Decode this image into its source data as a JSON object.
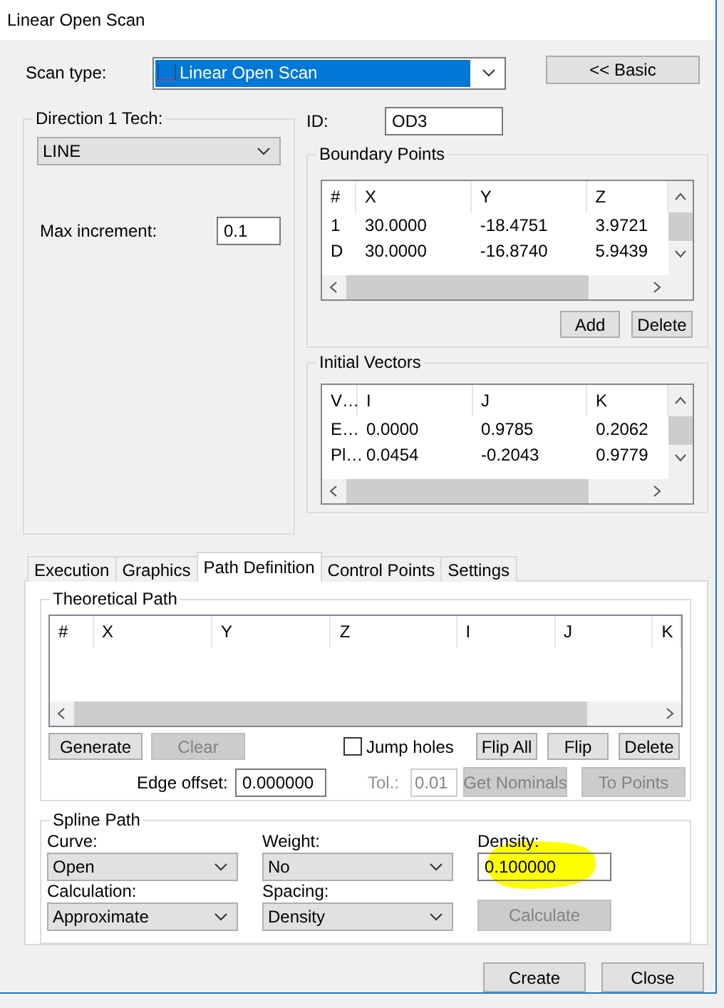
{
  "window": {
    "title": "Linear Open Scan"
  },
  "scan_type": {
    "label": "Scan type:",
    "value": "Linear Open Scan"
  },
  "basic_button": "<< Basic",
  "direction_tech": {
    "title": "Direction 1 Tech:",
    "value": "LINE",
    "max_increment_label": "Max increment:",
    "max_increment": "0.1"
  },
  "id": {
    "label": "ID:",
    "value": "OD3"
  },
  "boundary_points": {
    "title": "Boundary Points",
    "columns": [
      "#",
      "X",
      "Y",
      "Z"
    ],
    "rows": [
      [
        "1",
        "30.0000",
        "-18.4751",
        "3.9721"
      ],
      [
        "D",
        "30.0000",
        "-16.8740",
        "5.9439"
      ]
    ],
    "buttons": [
      "Add",
      "Delete"
    ]
  },
  "initial_vectors": {
    "title": "Initial Vectors",
    "columns": [
      "V…",
      "I",
      "J",
      "K"
    ],
    "rows": [
      [
        "E…",
        "0.0000",
        "0.9785",
        "0.2062"
      ],
      [
        "Pl…",
        "0.0454",
        "-0.2043",
        "0.9779"
      ]
    ]
  },
  "tabs": [
    {
      "label": "Execution",
      "selected": false
    },
    {
      "label": "Graphics",
      "selected": false
    },
    {
      "label": "Path Definition",
      "selected": true
    },
    {
      "label": "Control Points",
      "selected": false
    },
    {
      "label": "Settings",
      "selected": false
    }
  ],
  "theoretical_path": {
    "title": "Theoretical Path",
    "columns": [
      "#",
      "X",
      "Y",
      "Z",
      "I",
      "J",
      "K"
    ],
    "buttons": [
      {
        "label": "Generate",
        "disabled": false
      },
      {
        "label": "Clear",
        "disabled": true
      }
    ],
    "jump_holes": {
      "label": "Jump holes",
      "checked": false
    },
    "flip_buttons": [
      "Flip All",
      "Flip",
      "Delete"
    ],
    "edge_offset": {
      "label": "Edge offset:",
      "value": "0.000000"
    },
    "tolerance": {
      "label": "Tol.:",
      "value": "0.01",
      "disabled": true
    },
    "nominal_buttons": [
      {
        "label": "Get Nominals",
        "disabled": true
      },
      {
        "label": "To Points",
        "disabled": true
      }
    ]
  },
  "spline_path": {
    "title": "Spline Path",
    "fields": [
      {
        "kind": "combo",
        "label": "Curve:",
        "value": "Open"
      },
      {
        "kind": "combo",
        "label": "Weight:",
        "value": "No"
      },
      {
        "kind": "text",
        "label": "Density:",
        "value": "0.100000",
        "highlighted": true
      },
      {
        "kind": "combo",
        "label": "Calculation:",
        "value": "Approximate"
      },
      {
        "kind": "combo",
        "label": "Spacing:",
        "value": "Density"
      },
      {
        "kind": "button",
        "label": "Calculate",
        "disabled": true
      }
    ]
  },
  "footer_buttons": [
    "Create",
    "Close"
  ]
}
